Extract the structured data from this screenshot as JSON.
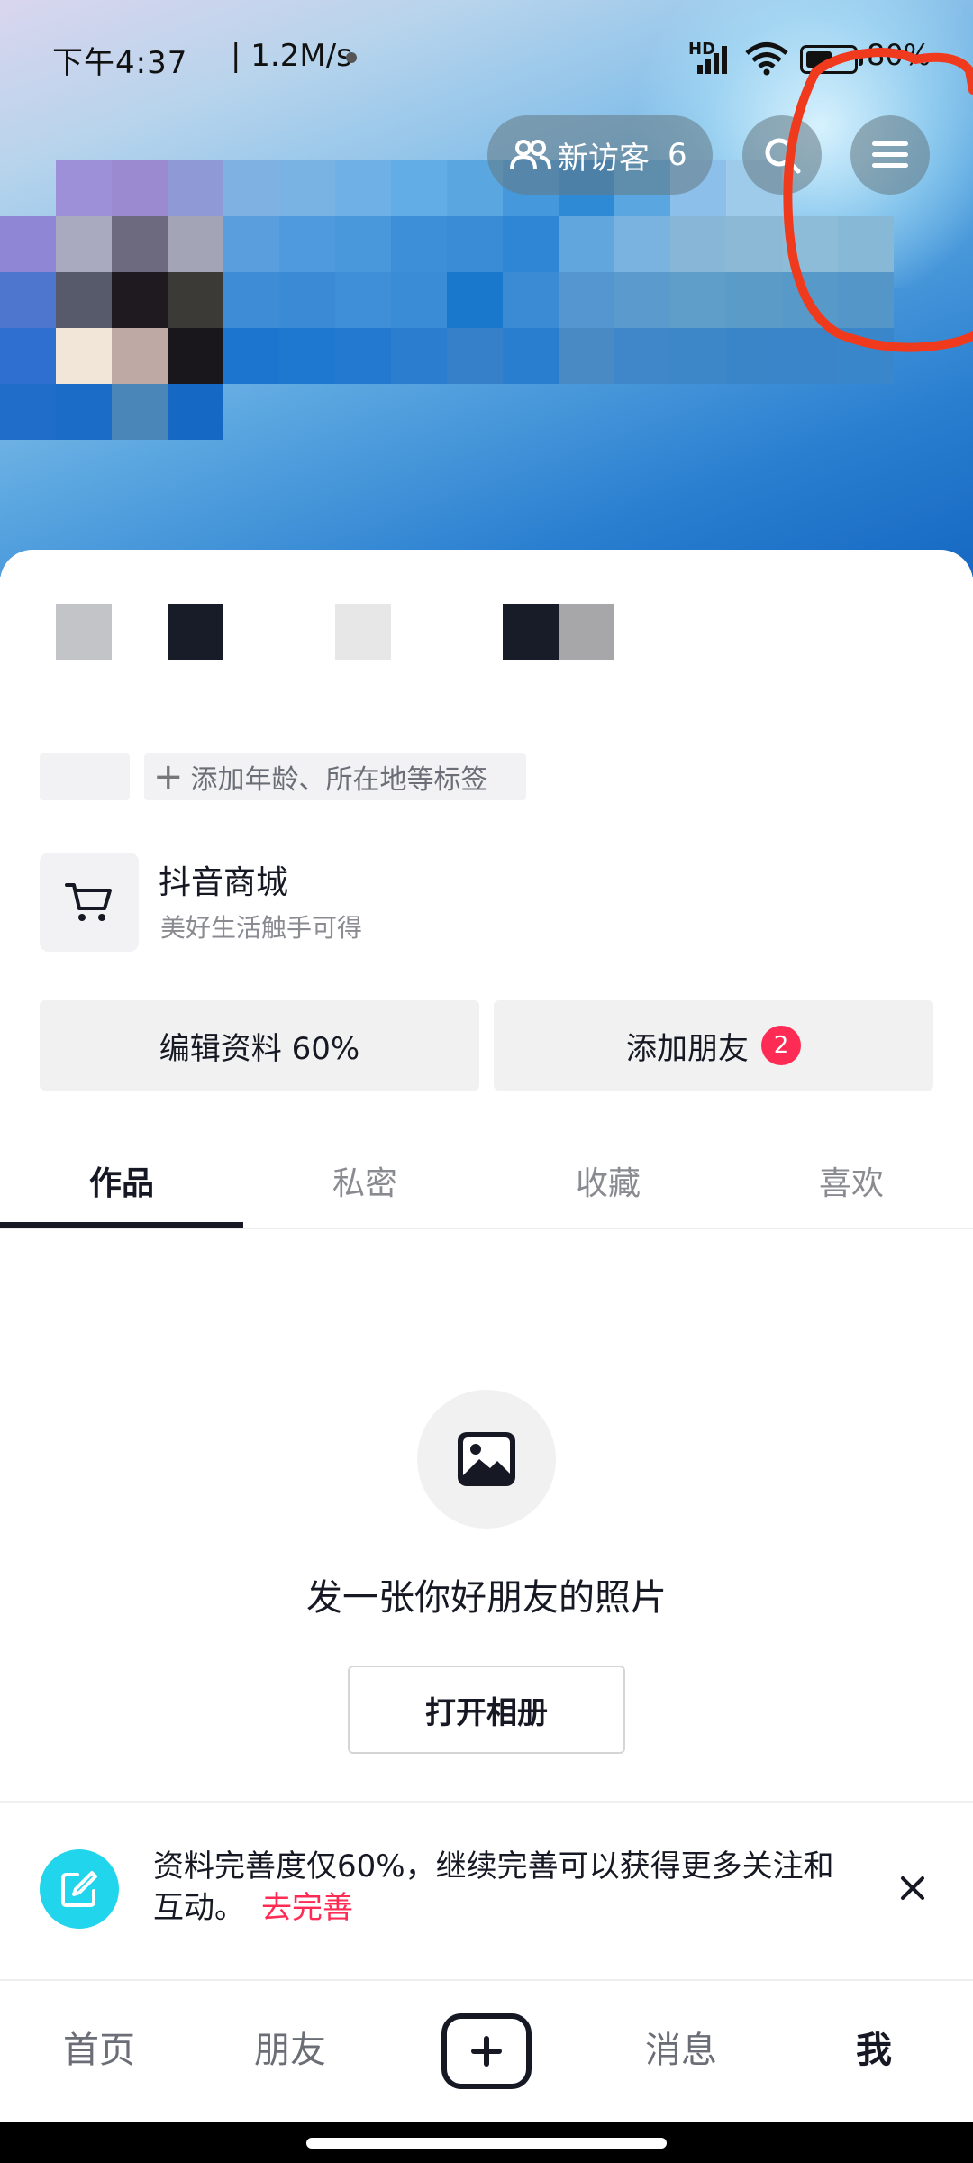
{
  "status_bar": {
    "time": "下午4:37",
    "network": "| 1.2M/s",
    "hd": "HD",
    "battery_percent": "80%"
  },
  "header": {
    "visitor_label": "新访客",
    "visitor_count": "6"
  },
  "profile": {
    "tag_add": "添加年龄、所在地等标签",
    "shop_title": "抖音商城",
    "shop_subtitle": "美好生活触手可得",
    "edit_profile": "编辑资料 60%",
    "add_friends": "添加朋友",
    "add_friends_badge": "2"
  },
  "tabs": [
    {
      "label": "作品"
    },
    {
      "label": "私密"
    },
    {
      "label": "收藏"
    },
    {
      "label": "喜欢"
    }
  ],
  "empty_state": {
    "text": "发一张你好朋友的照片",
    "button": "打开相册"
  },
  "tip": {
    "text": "资料完善度仅60%，继续完善可以获得更多关注和互动。",
    "link": "去完善"
  },
  "bottom_nav": {
    "home": "首页",
    "friends": "朋友",
    "messages": "消息",
    "me": "我"
  },
  "colors": {
    "accent": "#fe2c55",
    "tip_icon": "#20d5ec",
    "text_primary": "#161823",
    "annotation": "#f03a1e"
  }
}
